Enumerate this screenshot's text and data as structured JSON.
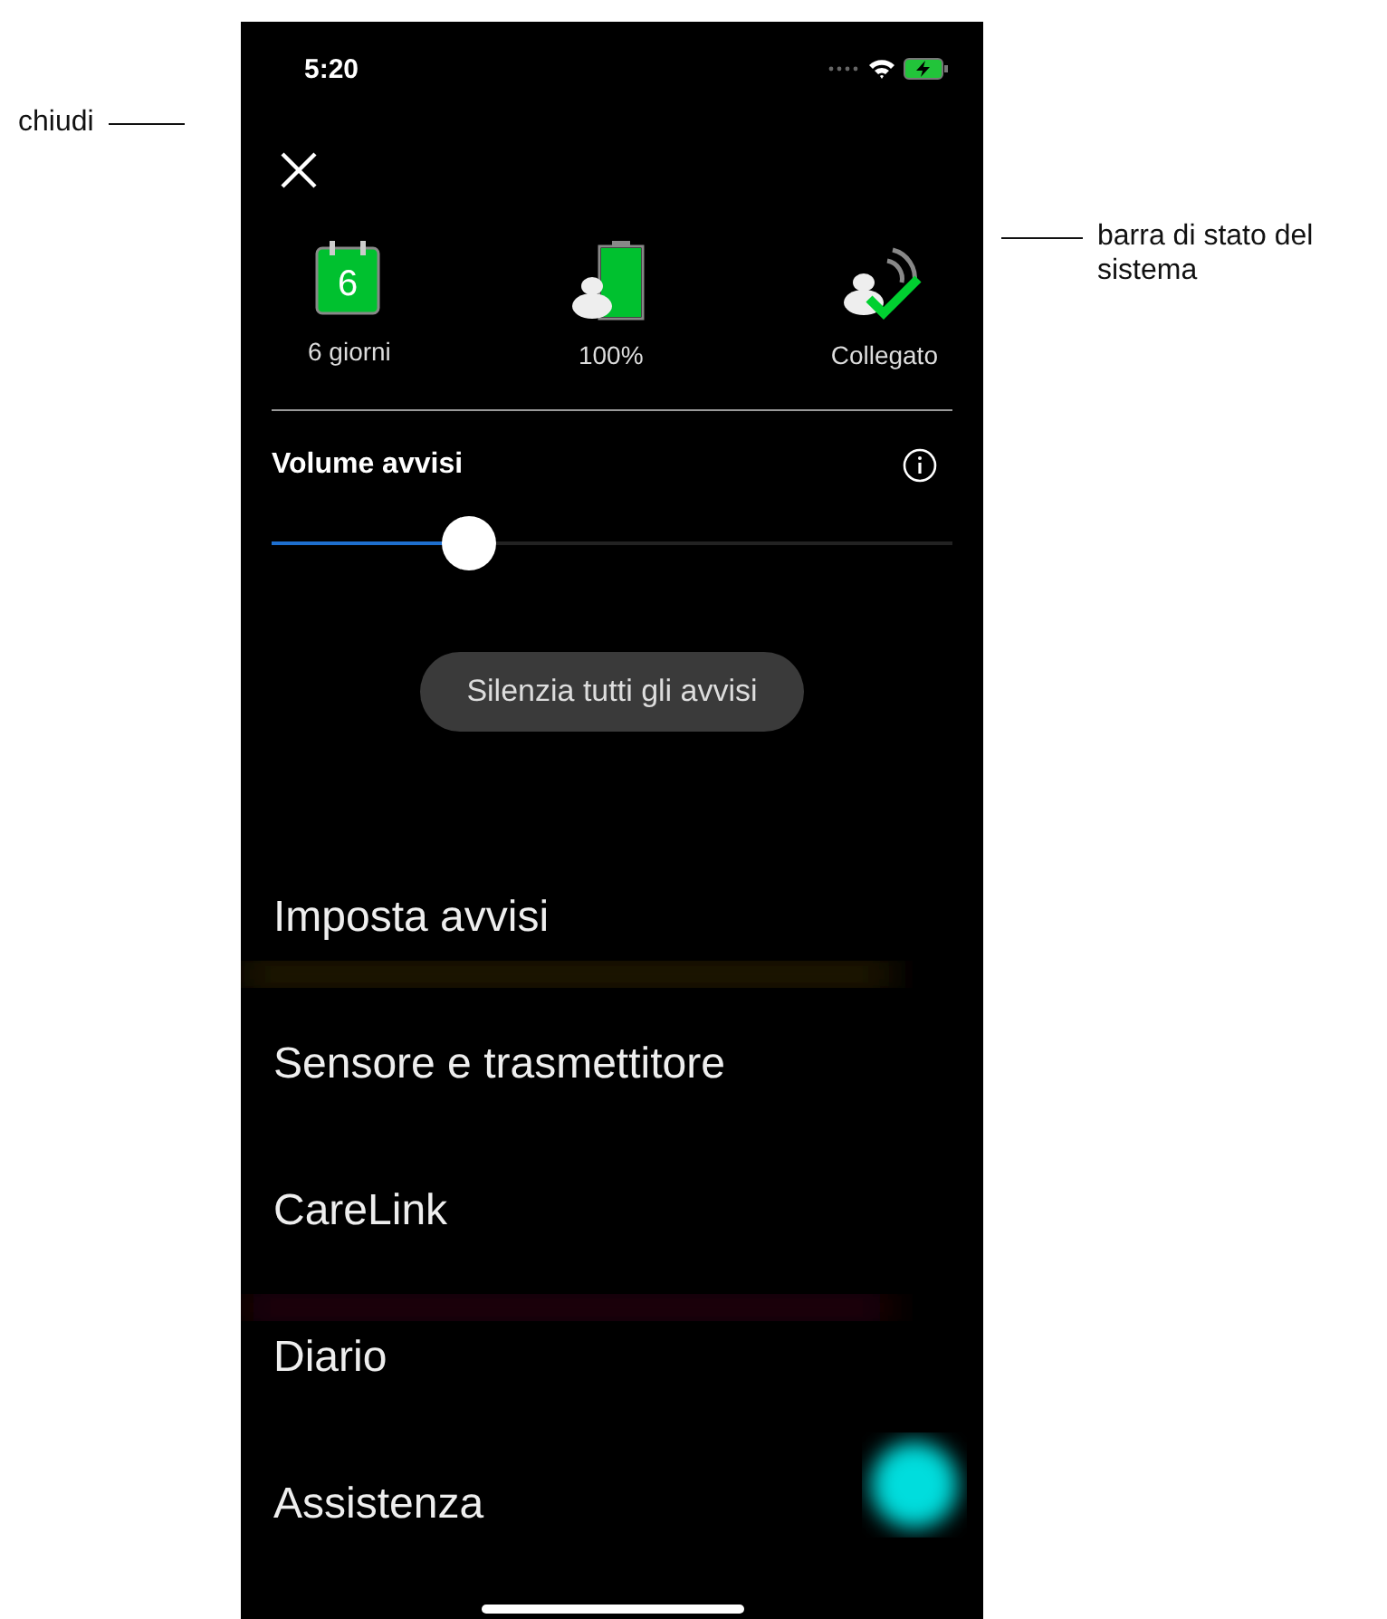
{
  "callouts": [
    {
      "kind": "left",
      "text": "chiudi"
    },
    {
      "kind": "right",
      "text": "barra di stato del sistema"
    }
  ],
  "status_bar": {
    "time": "5:20"
  },
  "status_items": [
    {
      "kind": "calendar",
      "value": "6",
      "label": "6 giorni"
    },
    {
      "kind": "battery",
      "label": "100%",
      "level": 1
    },
    {
      "kind": "connection",
      "label": "Collegato"
    }
  ],
  "volume": {
    "label": "Volume avvisi",
    "level": 0.29
  },
  "mute_button": "Silenzia tutti gli avvisi",
  "menu": [
    "Imposta avvisi",
    "Sensore e trasmettitore",
    "CareLink",
    "Diario",
    "Assistenza"
  ]
}
